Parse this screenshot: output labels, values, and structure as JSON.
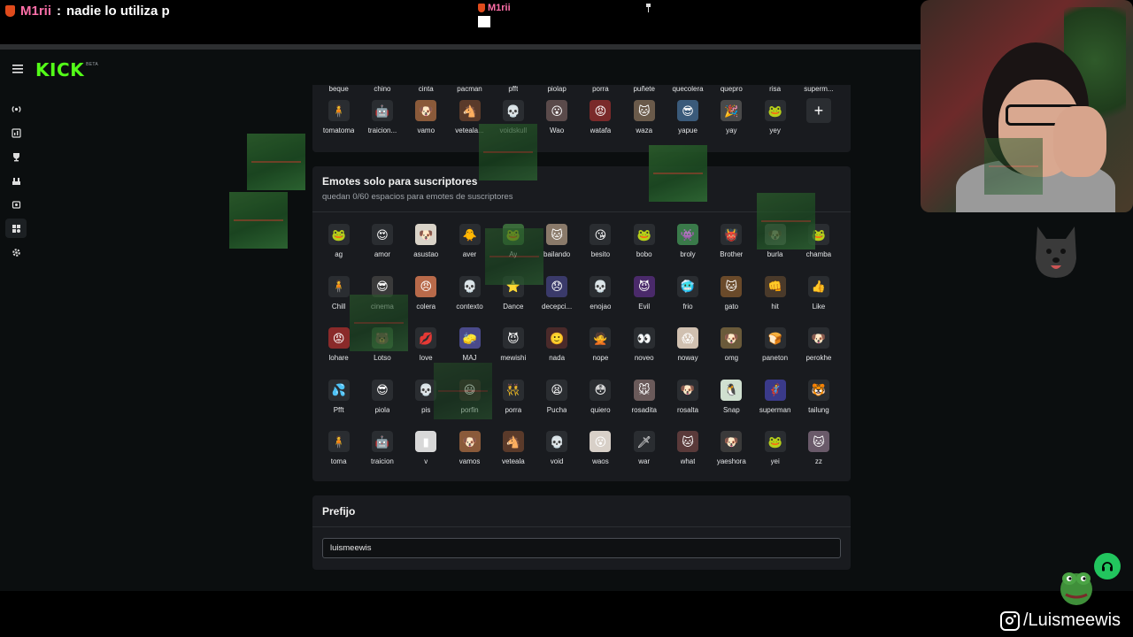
{
  "chat": {
    "user": "M1rii",
    "separator": ":",
    "message": "nadie lo utiliza p"
  },
  "center_overlay": {
    "user": "M1rii"
  },
  "kick": {
    "logo": "KICK",
    "badge": "BETA"
  },
  "nav": [
    {
      "icon": "live-icon"
    },
    {
      "icon": "dashboard-icon"
    },
    {
      "icon": "trophy-icon"
    },
    {
      "icon": "community-icon"
    },
    {
      "icon": "moderation-icon"
    },
    {
      "icon": "emotes-icon",
      "active": true
    },
    {
      "icon": "gear-icon"
    }
  ],
  "channel_emotes": {
    "clipped_row": [
      "beque",
      "chino",
      "cinta",
      "pacman",
      "pfft",
      "piolap",
      "porra",
      "puñete",
      "quecolera",
      "quepro",
      "risa",
      "superm..."
    ],
    "last_row": [
      {
        "name": "tomatoma",
        "glyph": "🧍",
        "bg": "#2a2d31"
      },
      {
        "name": "traicion...",
        "glyph": "🤖",
        "bg": "#2a2d31"
      },
      {
        "name": "vamo",
        "glyph": "🐶",
        "bg": "#8a5a3a"
      },
      {
        "name": "veteala...",
        "glyph": "🐴",
        "bg": "#5a3a2a"
      },
      {
        "name": "voidskull",
        "glyph": "💀",
        "bg": "#2a2d31"
      },
      {
        "name": "Wao",
        "glyph": "😮",
        "bg": "#5a4a4a"
      },
      {
        "name": "watafa",
        "glyph": "😡",
        "bg": "#7a2a2a"
      },
      {
        "name": "waza",
        "glyph": "🐱",
        "bg": "#6a5a4a"
      },
      {
        "name": "yapue",
        "glyph": "😎",
        "bg": "#3a5a7a"
      },
      {
        "name": "yay",
        "glyph": "🎉",
        "bg": "#4a4a4a"
      },
      {
        "name": "yey",
        "glyph": "🐸",
        "bg": "#2a2d31"
      }
    ],
    "add_label": "+"
  },
  "subscriber_emotes": {
    "title": "Emotes solo para suscriptores",
    "description": "quedan 0/60 espacios para emotes de suscriptores",
    "emotes": [
      {
        "name": "ag",
        "glyph": "🐸",
        "bg": "#2a2d31"
      },
      {
        "name": "amor",
        "glyph": "😍",
        "bg": "#2a2d31"
      },
      {
        "name": "asustao",
        "glyph": "🐶",
        "bg": "#d9d3c8"
      },
      {
        "name": "aver",
        "glyph": "🐥",
        "bg": "#2a2d31"
      },
      {
        "name": "Ay",
        "glyph": "🐸",
        "bg": "#3a6a3a"
      },
      {
        "name": "bailando",
        "glyph": "🐱",
        "bg": "#8a7a6a"
      },
      {
        "name": "besito",
        "glyph": "😘",
        "bg": "#2a2d31"
      },
      {
        "name": "bobo",
        "glyph": "🐸",
        "bg": "#2a2d31"
      },
      {
        "name": "broly",
        "glyph": "👾",
        "bg": "#3a7a4a"
      },
      {
        "name": "Brother",
        "glyph": "👹",
        "bg": "#2a2d31"
      },
      {
        "name": "burla",
        "glyph": "🐶",
        "bg": "#6a6a6a"
      },
      {
        "name": "chamba",
        "glyph": "🐸",
        "bg": "#2a2d31"
      },
      {
        "name": "Chill",
        "glyph": "🧍",
        "bg": "#2a2d31"
      },
      {
        "name": "cinema",
        "glyph": "😎",
        "bg": "#3a3a3a"
      },
      {
        "name": "colera",
        "glyph": "😠",
        "bg": "#b86a4a"
      },
      {
        "name": "contexto",
        "glyph": "💀",
        "bg": "#2a2d31"
      },
      {
        "name": "Dance",
        "glyph": "⭐",
        "bg": "#2a2d31"
      },
      {
        "name": "decepci...",
        "glyph": "😞",
        "bg": "#3a3a6a"
      },
      {
        "name": "enojao",
        "glyph": "💀",
        "bg": "#2a2d31"
      },
      {
        "name": "Evil",
        "glyph": "😈",
        "bg": "#4a2a6a"
      },
      {
        "name": "frio",
        "glyph": "🥶",
        "bg": "#2a2d31"
      },
      {
        "name": "gato",
        "glyph": "🐱",
        "bg": "#6a4a2a"
      },
      {
        "name": "hit",
        "glyph": "👊",
        "bg": "#4a3a2a"
      },
      {
        "name": "Like",
        "glyph": "👍",
        "bg": "#2a2d31"
      },
      {
        "name": "lohare",
        "glyph": "😡",
        "bg": "#8a2a2a"
      },
      {
        "name": "Lotso",
        "glyph": "🐻",
        "bg": "#3a5a3a"
      },
      {
        "name": "love",
        "glyph": "💋",
        "bg": "#2a2d31"
      },
      {
        "name": "MAJ",
        "glyph": "🧽",
        "bg": "#4a4a8a"
      },
      {
        "name": "mewishi",
        "glyph": "😈",
        "bg": "#2a2d31"
      },
      {
        "name": "nada",
        "glyph": "🙂",
        "bg": "#4a2a2a"
      },
      {
        "name": "nope",
        "glyph": "🙅",
        "bg": "#2a2d31"
      },
      {
        "name": "noveo",
        "glyph": "👀",
        "bg": "#2a2d31"
      },
      {
        "name": "noway",
        "glyph": "😱",
        "bg": "#d0c0b0"
      },
      {
        "name": "omg",
        "glyph": "🐶",
        "bg": "#6a5a3a"
      },
      {
        "name": "paneton",
        "glyph": "🍞",
        "bg": "#2a2d31"
      },
      {
        "name": "perokhe",
        "glyph": "🐶",
        "bg": "#2a2d31"
      },
      {
        "name": "Pfft",
        "glyph": "💦",
        "bg": "#2a2d31"
      },
      {
        "name": "piola",
        "glyph": "😎",
        "bg": "#2a2d31"
      },
      {
        "name": "pis",
        "glyph": "💀",
        "bg": "#2a2d31"
      },
      {
        "name": "porfin",
        "glyph": "😃",
        "bg": "#3a2a2a"
      },
      {
        "name": "porra",
        "glyph": "👯",
        "bg": "#2a2d31"
      },
      {
        "name": "Pucha",
        "glyph": "😫",
        "bg": "#2a2d31"
      },
      {
        "name": "quiero",
        "glyph": "😳",
        "bg": "#2a2d31"
      },
      {
        "name": "rosadita",
        "glyph": "🐭",
        "bg": "#6a5a5a"
      },
      {
        "name": "rosalta",
        "glyph": "🐶",
        "bg": "#2a2d31"
      },
      {
        "name": "Snap",
        "glyph": "🐧",
        "bg": "#d0e0d0"
      },
      {
        "name": "superman",
        "glyph": "🦸",
        "bg": "#3a3a8a"
      },
      {
        "name": "tailung",
        "glyph": "🐯",
        "bg": "#2a2d31"
      },
      {
        "name": "toma",
        "glyph": "🧍",
        "bg": "#2a2d31"
      },
      {
        "name": "traicion",
        "glyph": "🤖",
        "bg": "#2a2d31"
      },
      {
        "name": "v",
        "glyph": "▮",
        "bg": "#d8d8d8"
      },
      {
        "name": "vamos",
        "glyph": "🐶",
        "bg": "#8a5a3a"
      },
      {
        "name": "veteala",
        "glyph": "🐴",
        "bg": "#5a3a2a"
      },
      {
        "name": "void",
        "glyph": "💀",
        "bg": "#2a2d31"
      },
      {
        "name": "waos",
        "glyph": "😮",
        "bg": "#d8d0c8"
      },
      {
        "name": "war",
        "glyph": "🗡",
        "bg": "#2a2d31"
      },
      {
        "name": "what",
        "glyph": "🐱",
        "bg": "#5a3a3a"
      },
      {
        "name": "yaeshora",
        "glyph": "🐶",
        "bg": "#3a3a3a"
      },
      {
        "name": "yei",
        "glyph": "🐸",
        "bg": "#2a2d31"
      },
      {
        "name": "zz",
        "glyph": "🐱",
        "bg": "#6a5a6a"
      }
    ]
  },
  "prefix": {
    "title": "Prefijo",
    "value": "luismeewis"
  },
  "social": {
    "handle": "/Luismeewis"
  },
  "colors": {
    "kick_green": "#53fc18",
    "panel": "#191b1f",
    "page": "#0b0e0f"
  }
}
